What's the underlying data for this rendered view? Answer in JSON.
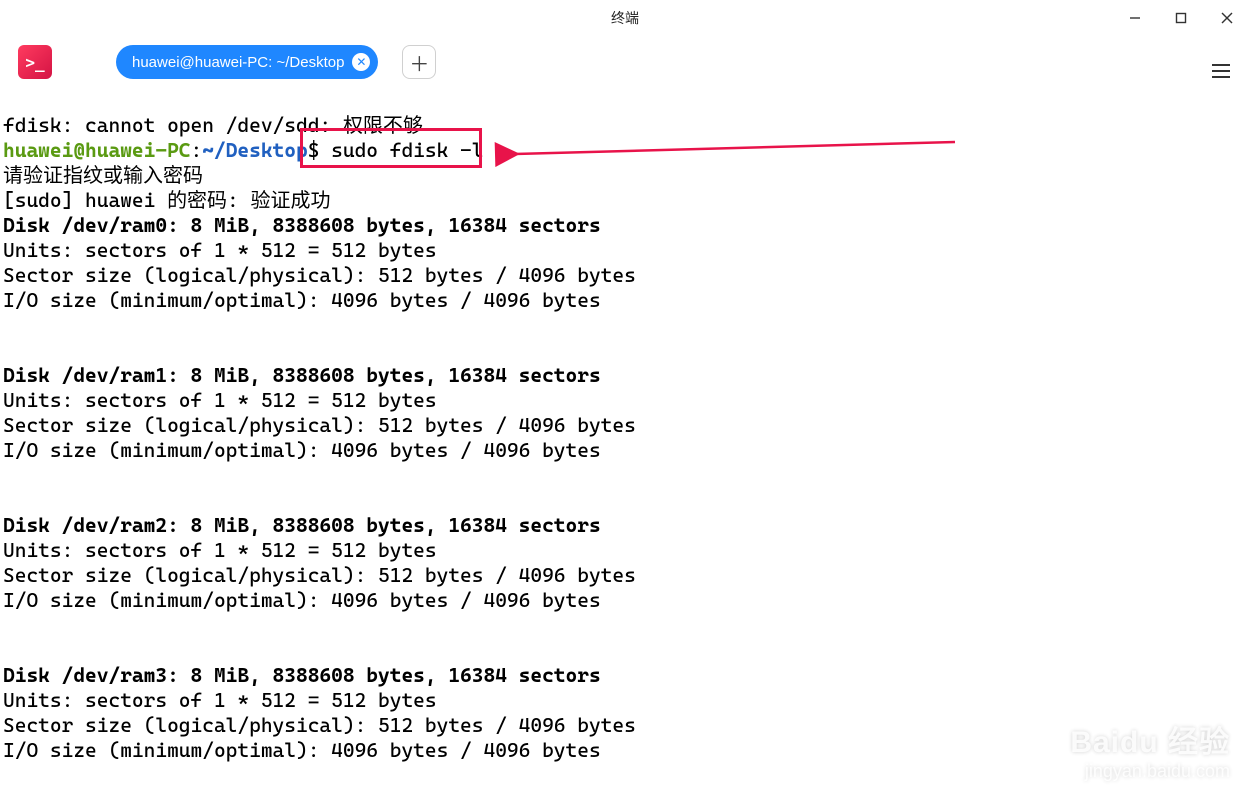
{
  "window": {
    "title": "终端"
  },
  "tab": {
    "label": "huawei@huawei-PC: ~/Desktop"
  },
  "prompt": {
    "userhost": "huawei@huawei-PC",
    "colon": ":",
    "path": "~/Desktop",
    "dollar": "$",
    "cmd": " sudo fdisk -l"
  },
  "lines": {
    "err": "fdisk: cannot open /dev/sdd: 权限不够",
    "auth1": "请验证指纹或输入密码",
    "auth2": "[sudo] huawei 的密码: 验证成功",
    "disk0h": "Disk /dev/ram0: 8 MiB, 8388608 bytes, 16384 sectors",
    "units": "Units: sectors of 1 * 512 = 512 bytes",
    "sect": "Sector size (logical/physical): 512 bytes / 4096 bytes",
    "io": "I/O size (minimum/optimal): 4096 bytes / 4096 bytes",
    "disk1h": "Disk /dev/ram1: 8 MiB, 8388608 bytes, 16384 sectors",
    "disk2h": "Disk /dev/ram2: 8 MiB, 8388608 bytes, 16384 sectors",
    "disk3h": "Disk /dev/ram3: 8 MiB, 8388608 bytes, 16384 sectors"
  },
  "watermark": {
    "top": "Baidu 经验",
    "bottom": "jingyan.baidu.com"
  }
}
